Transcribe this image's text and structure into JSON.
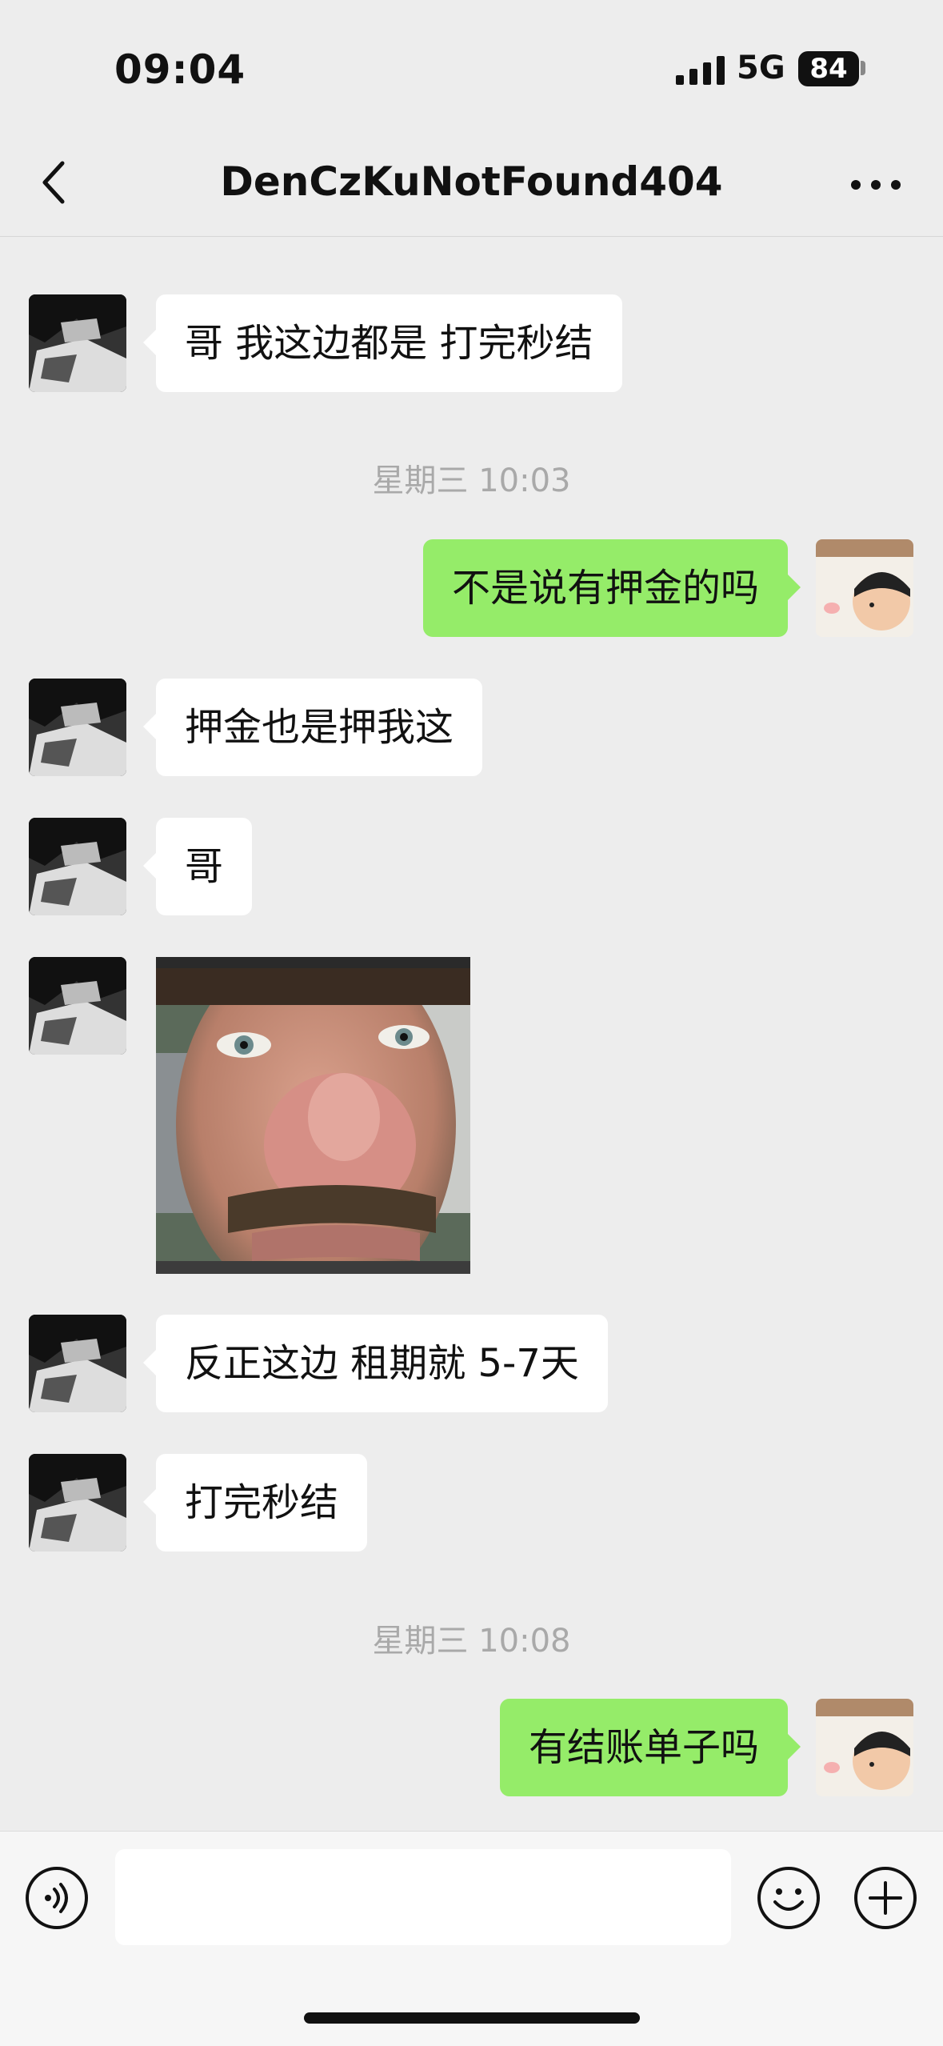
{
  "status_bar": {
    "time": "09:04",
    "network": "5G",
    "battery": "84"
  },
  "nav": {
    "title": "DenCzKuNotFound404"
  },
  "messages": [
    {
      "side": "left",
      "text": "哥 我这边都是 打完秒结"
    },
    {
      "timestamp": "星期三 10:03"
    },
    {
      "side": "right",
      "text": "不是说有押金的吗"
    },
    {
      "side": "left",
      "text": "押金也是押我这"
    },
    {
      "side": "left",
      "text": "哥"
    },
    {
      "side": "left",
      "type": "image",
      "alt": "close-up face photo"
    },
    {
      "side": "left",
      "text": "反正这边 租期就 5-7天"
    },
    {
      "side": "left",
      "text": "打完秒结"
    },
    {
      "timestamp": "星期三 10:08"
    },
    {
      "side": "right",
      "text": "有结账单子吗"
    }
  ],
  "colors": {
    "background": "#ededed",
    "bubble_self": "#95ec69",
    "bubble_other": "#ffffff"
  },
  "input_bar": {
    "value": "",
    "icons": [
      "voice-icon",
      "emoji-icon",
      "plus-icon"
    ]
  }
}
